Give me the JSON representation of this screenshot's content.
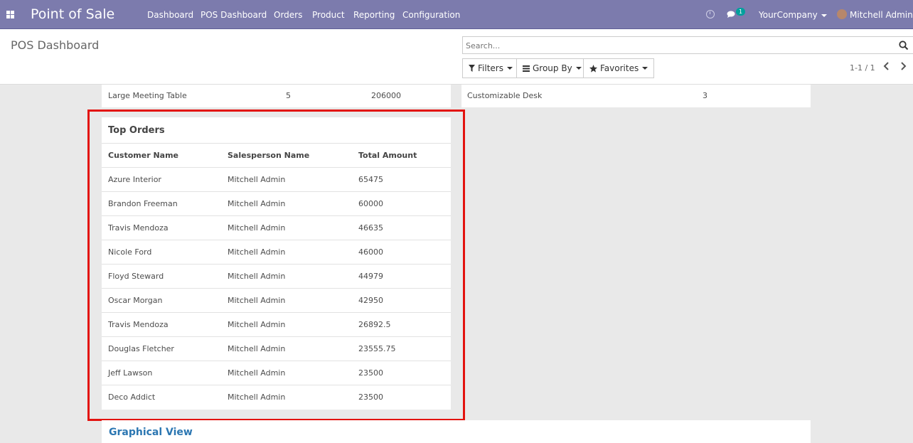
{
  "navbar": {
    "brand": "Point of Sale",
    "menu": [
      "Dashboard",
      "POS Dashboard",
      "Orders",
      "Product",
      "Reporting",
      "Configuration"
    ],
    "chat_count": "1",
    "company": "YourCompany",
    "user": "Mitchell Admin"
  },
  "control_panel": {
    "title": "POS Dashboard",
    "search_placeholder": "Search...",
    "filters_label": "Filters",
    "group_by_label": "Group By",
    "favorites_label": "Favorites",
    "pager": "1-1 / 1"
  },
  "top_products_row": {
    "left": {
      "name": "Large Meeting Table",
      "qty": "5",
      "amount": "206000"
    },
    "right": {
      "name": "Customizable Desk",
      "qty": "3"
    }
  },
  "top_orders": {
    "title": "Top Orders",
    "headers": [
      "Customer Name",
      "Salesperson Name",
      "Total Amount"
    ],
    "rows": [
      [
        "Azure Interior",
        "Mitchell Admin",
        "65475"
      ],
      [
        "Brandon Freeman",
        "Mitchell Admin",
        "60000"
      ],
      [
        "Travis Mendoza",
        "Mitchell Admin",
        "46635"
      ],
      [
        "Nicole Ford",
        "Mitchell Admin",
        "46000"
      ],
      [
        "Floyd Steward",
        "Mitchell Admin",
        "44979"
      ],
      [
        "Oscar Morgan",
        "Mitchell Admin",
        "42950"
      ],
      [
        "Travis Mendoza",
        "Mitchell Admin",
        "26892.5"
      ],
      [
        "Douglas Fletcher",
        "Mitchell Admin",
        "23555.75"
      ],
      [
        "Jeff Lawson",
        "Mitchell Admin",
        "23500"
      ],
      [
        "Deco Addict",
        "Mitchell Admin",
        "23500"
      ]
    ]
  },
  "graphical_view": {
    "title": "Graphical View"
  },
  "colors": {
    "navbar": "#7c7bad",
    "highlight": "#e3130f",
    "link": "#2c77b2",
    "badge": "#00a09d"
  }
}
